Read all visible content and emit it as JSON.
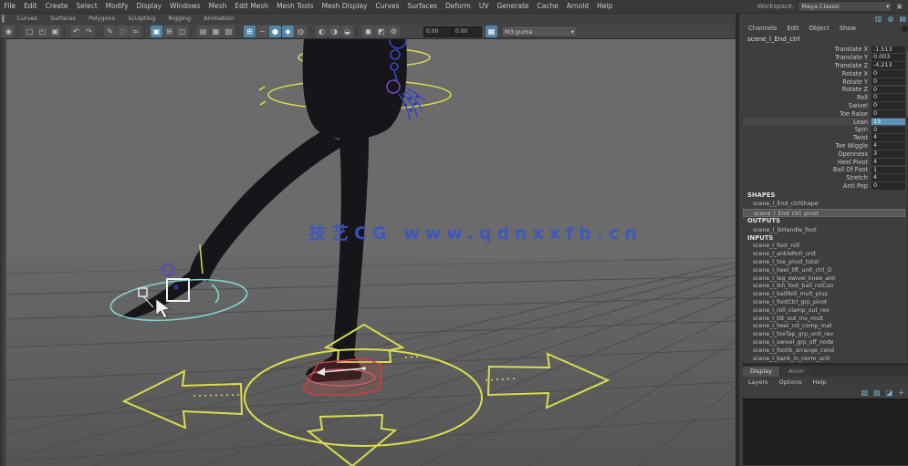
{
  "menubar": {
    "items": [
      "File",
      "Edit",
      "Create",
      "Select",
      "Modify",
      "Display",
      "Windows",
      "Mesh",
      "Edit Mesh",
      "Mesh Tools",
      "Mesh Display",
      "Curves",
      "Surfaces",
      "Deform",
      "UV",
      "Generate",
      "Cache",
      "Arnold",
      "Help"
    ],
    "workspace_label": "Workspace:",
    "workspace_value": "Maya Classic",
    "window_icon": "▣"
  },
  "shelf": {
    "edge_icon": "▌",
    "tabs": [
      "Curves",
      "Surfaces",
      "Polygons",
      "Sculpting",
      "Rigging",
      "Animation"
    ]
  },
  "statusline": {
    "icons": [
      {
        "name": "menu-set-icon",
        "glyph": "◉"
      },
      {
        "name": "divider",
        "glyph": ""
      },
      {
        "name": "new-scene-icon",
        "glyph": "▢"
      },
      {
        "name": "open-scene-icon",
        "glyph": "◰"
      },
      {
        "name": "save-scene-icon",
        "glyph": "▣"
      },
      {
        "name": "divider",
        "glyph": ""
      },
      {
        "name": "undo-icon",
        "glyph": "↶"
      },
      {
        "name": "redo-icon",
        "glyph": "↷"
      },
      {
        "name": "divider",
        "glyph": ""
      },
      {
        "name": "select-tool-icon",
        "glyph": "✎"
      },
      {
        "name": "lasso-tool-icon",
        "glyph": "◌"
      },
      {
        "name": "paint-select-icon",
        "glyph": "≈"
      },
      {
        "name": "divider",
        "glyph": ""
      },
      {
        "name": "layout-single-icon",
        "glyph": "▣",
        "active": true
      },
      {
        "name": "layout-four-icon",
        "glyph": "⊞"
      },
      {
        "name": "layout-split-icon",
        "glyph": "◫"
      },
      {
        "name": "divider",
        "glyph": ""
      },
      {
        "name": "select-hierarchy-icon",
        "glyph": "▤"
      },
      {
        "name": "select-object-icon",
        "glyph": "▦"
      },
      {
        "name": "select-component-icon",
        "glyph": "▧"
      },
      {
        "name": "divider",
        "glyph": ""
      },
      {
        "name": "snap-grid-icon",
        "glyph": "⊞",
        "active": true
      },
      {
        "name": "snap-curve-icon",
        "glyph": "~"
      },
      {
        "name": "snap-point-icon",
        "glyph": "●",
        "active": true
      },
      {
        "name": "snap-plane-icon",
        "glyph": "◆",
        "active": true
      },
      {
        "name": "make-live-icon",
        "glyph": "◍"
      },
      {
        "name": "divider",
        "glyph": ""
      },
      {
        "name": "input-connections-icon",
        "glyph": "◐"
      },
      {
        "name": "output-connections-icon",
        "glyph": "◑"
      },
      {
        "name": "history-icon",
        "glyph": "◒"
      },
      {
        "name": "divider",
        "glyph": ""
      },
      {
        "name": "render-frame-icon",
        "glyph": "◼"
      },
      {
        "name": "ipr-render-icon",
        "glyph": "◩"
      },
      {
        "name": "render-settings-icon",
        "glyph": "⚙"
      }
    ],
    "fields": [
      {
        "name": "transform-field-x",
        "value": "0.00"
      },
      {
        "name": "transform-field-y",
        "value": "0.00"
      }
    ],
    "grid_button_glyph": "▦",
    "combo_value": "M3:guma",
    "combo_caret": "▾"
  },
  "sidebar_toggles": [
    {
      "name": "modeling-toolkit-toggle-icon",
      "glyph": "▥"
    },
    {
      "name": "attribute-editor-toggle-icon",
      "glyph": "◍"
    },
    {
      "name": "channel-box-toggle-icon",
      "glyph": "▤"
    }
  ],
  "channelbox": {
    "menus": [
      "Channels",
      "Edit",
      "Object",
      "Show"
    ],
    "node_name": "scene_l_End_ctrl",
    "attributes": [
      {
        "name": "Translate X",
        "value": "-1.513"
      },
      {
        "name": "Translate Y",
        "value": "0.003"
      },
      {
        "name": "Translate Z",
        "value": "-4.213"
      },
      {
        "name": "Rotate X",
        "value": "0"
      },
      {
        "name": "Rotate Y",
        "value": "0"
      },
      {
        "name": "Rotate Z",
        "value": "0"
      },
      {
        "name": "Roll",
        "value": "0"
      },
      {
        "name": "Swivel",
        "value": "0"
      },
      {
        "name": "Toe Raise",
        "value": "0"
      },
      {
        "name": "Lean",
        "value": "13",
        "highlight": true
      },
      {
        "name": "Spin",
        "value": "0"
      },
      {
        "name": "Twist",
        "value": "4"
      },
      {
        "name": "Toe Wiggle",
        "value": "4"
      },
      {
        "name": "Openness",
        "value": "3"
      },
      {
        "name": "Heel Pivot",
        "value": "4"
      },
      {
        "name": "Ball Of Foot",
        "value": "1"
      },
      {
        "name": "Stretch",
        "value": "4"
      },
      {
        "name": "Anti Pop",
        "value": "0"
      }
    ],
    "shapes_header": "SHAPES",
    "shape_items": [
      {
        "label": "scene_l_End_ctrlShape"
      },
      {
        "label": "scene_l_End_ctrl_pivot",
        "selected": true
      }
    ],
    "outputs_header": "OUTPUTS",
    "output_items": [
      {
        "label": "scene_l_ikHandle_foot"
      }
    ],
    "inputs_header": "INPUTS",
    "input_items": [
      {
        "label": "scene_l_foot_roll"
      },
      {
        "label": "scene_l_ankleRoll_unit"
      },
      {
        "label": "scene_l_toe_pivot_total"
      },
      {
        "label": "scene_l_heel_lift_unit_ctrl_D"
      },
      {
        "label": "scene_l_leg_swivel_knee_aim"
      },
      {
        "label": "scene_l_ikh_foot_ball_rotCon"
      },
      {
        "label": "scene_l_ballRoll_mult_plus"
      },
      {
        "label": "scene_l_footCtrl_grp_pivot"
      },
      {
        "label": "scene_l_roll_clamp_out_rev"
      },
      {
        "label": "scene_l_tilt_out_inv_mult"
      },
      {
        "label": "scene_l_heel_rot_comp_mat"
      },
      {
        "label": "scene_l_toeTap_grp_unit_rev"
      },
      {
        "label": "scene_l_swivel_grp_off_node"
      },
      {
        "label": "scene_l_footIk_arrange_cond"
      },
      {
        "label": "scene_l_bank_in_norm_unit"
      }
    ]
  },
  "layer_editor": {
    "tabs": [
      {
        "label": "Display",
        "active": true
      },
      {
        "label": "Anim"
      }
    ],
    "menus": [
      "Layers",
      "Options",
      "Help"
    ],
    "icons": [
      {
        "name": "new-empty-layer-icon",
        "glyph": "▧"
      },
      {
        "name": "new-layer-selected-icon",
        "glyph": "▨"
      },
      {
        "name": "new-anim-layer-icon",
        "glyph": "◪"
      },
      {
        "name": "layer-move-icon",
        "glyph": "+"
      }
    ]
  },
  "viewport": {
    "watermark": "技艺CG  www.qdnxxfb.cn",
    "watermark_color": "#3a56c8",
    "colors": {
      "background": "#636363",
      "grid_line": "#4b4b4b",
      "manipulator_yellow": "#dcdc4e",
      "foot_ctrl_cyan": "#82d2d2",
      "foot_ctrl_red": "#cc4040",
      "skeleton_blue": "#3647c8",
      "pole_purple": "#5a3fd0",
      "selection_white": "#f2f2f2",
      "highlight_blue": "#5285a6"
    }
  }
}
